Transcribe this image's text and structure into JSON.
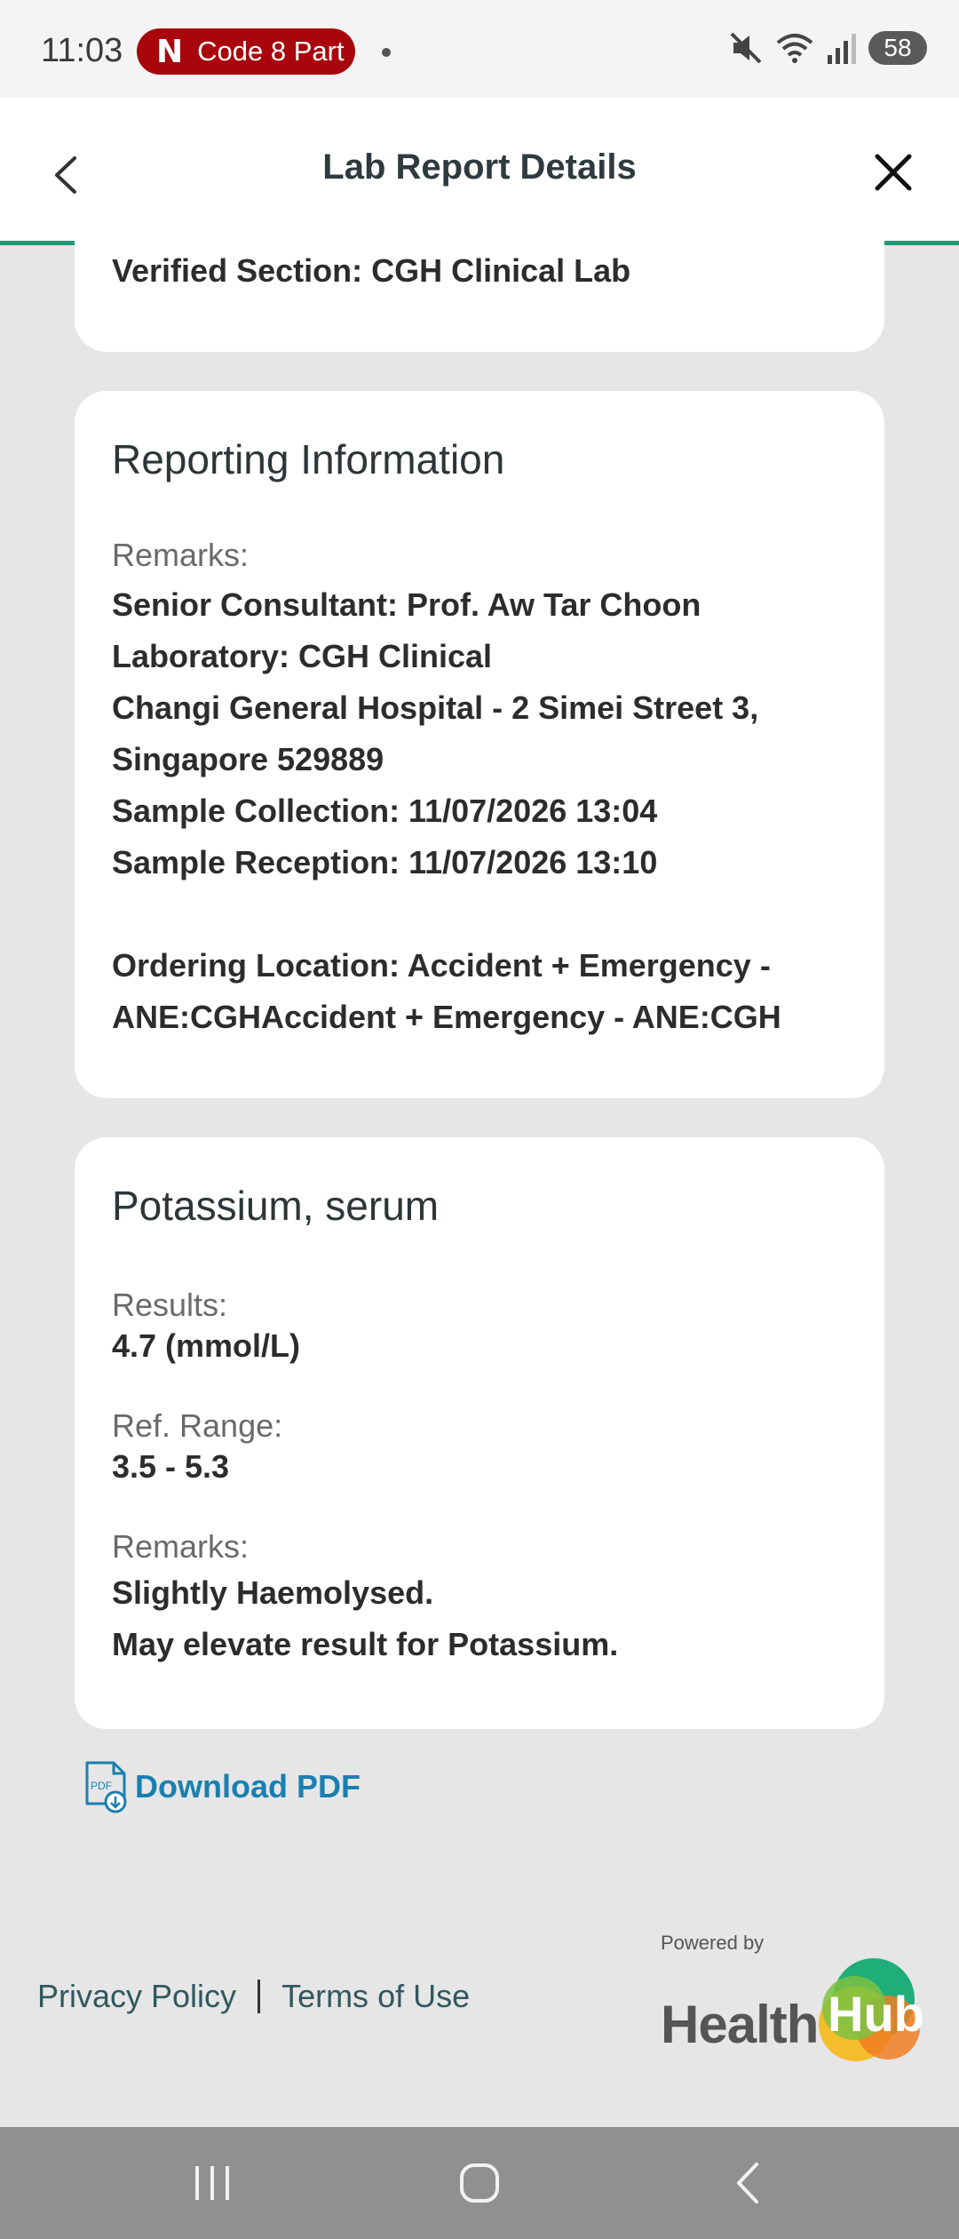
{
  "status_bar": {
    "time": "11:03",
    "notification": "Code 8 Part",
    "netflix_letter": "N",
    "battery": "58"
  },
  "header": {
    "title": "Lab Report Details"
  },
  "verified_card": {
    "text": "Verified Section: CGH Clinical Lab"
  },
  "reporting_card": {
    "title": "Reporting Information",
    "remarks_label": "Remarks:",
    "lines": [
      "Senior Consultant: Prof. Aw Tar Choon",
      "Laboratory: CGH Clinical",
      "Changi General Hospital - 2 Simei Street 3,",
      "Singapore 529889",
      "Sample Collection: 11/07/2026 13:04",
      "Sample Reception: 11/07/2026 13:10",
      "",
      "Ordering Location: Accident + Emergency -",
      "ANE:CGHAccident + Emergency - ANE:CGH"
    ]
  },
  "potassium_card": {
    "title": "Potassium, serum",
    "results_label": "Results:",
    "results_value": "4.7 (mmol/L)",
    "range_label": "Ref. Range:",
    "range_value": "3.5 - 5.3",
    "remarks_label": "Remarks:",
    "remarks_lines": [
      "Slightly Haemolysed.",
      "May elevate result for Potassium."
    ]
  },
  "download": {
    "label": "Download PDF",
    "icon_text": "PDF"
  },
  "footer": {
    "privacy": "Privacy Policy",
    "terms": "Terms of Use",
    "powered_by": "Powered by",
    "logo_health": "Health",
    "logo_hub": "Hub"
  },
  "colors": {
    "accent_green": "#1f9a74",
    "link_blue": "#1a7fb0",
    "netflix_red": "#a8060c"
  }
}
